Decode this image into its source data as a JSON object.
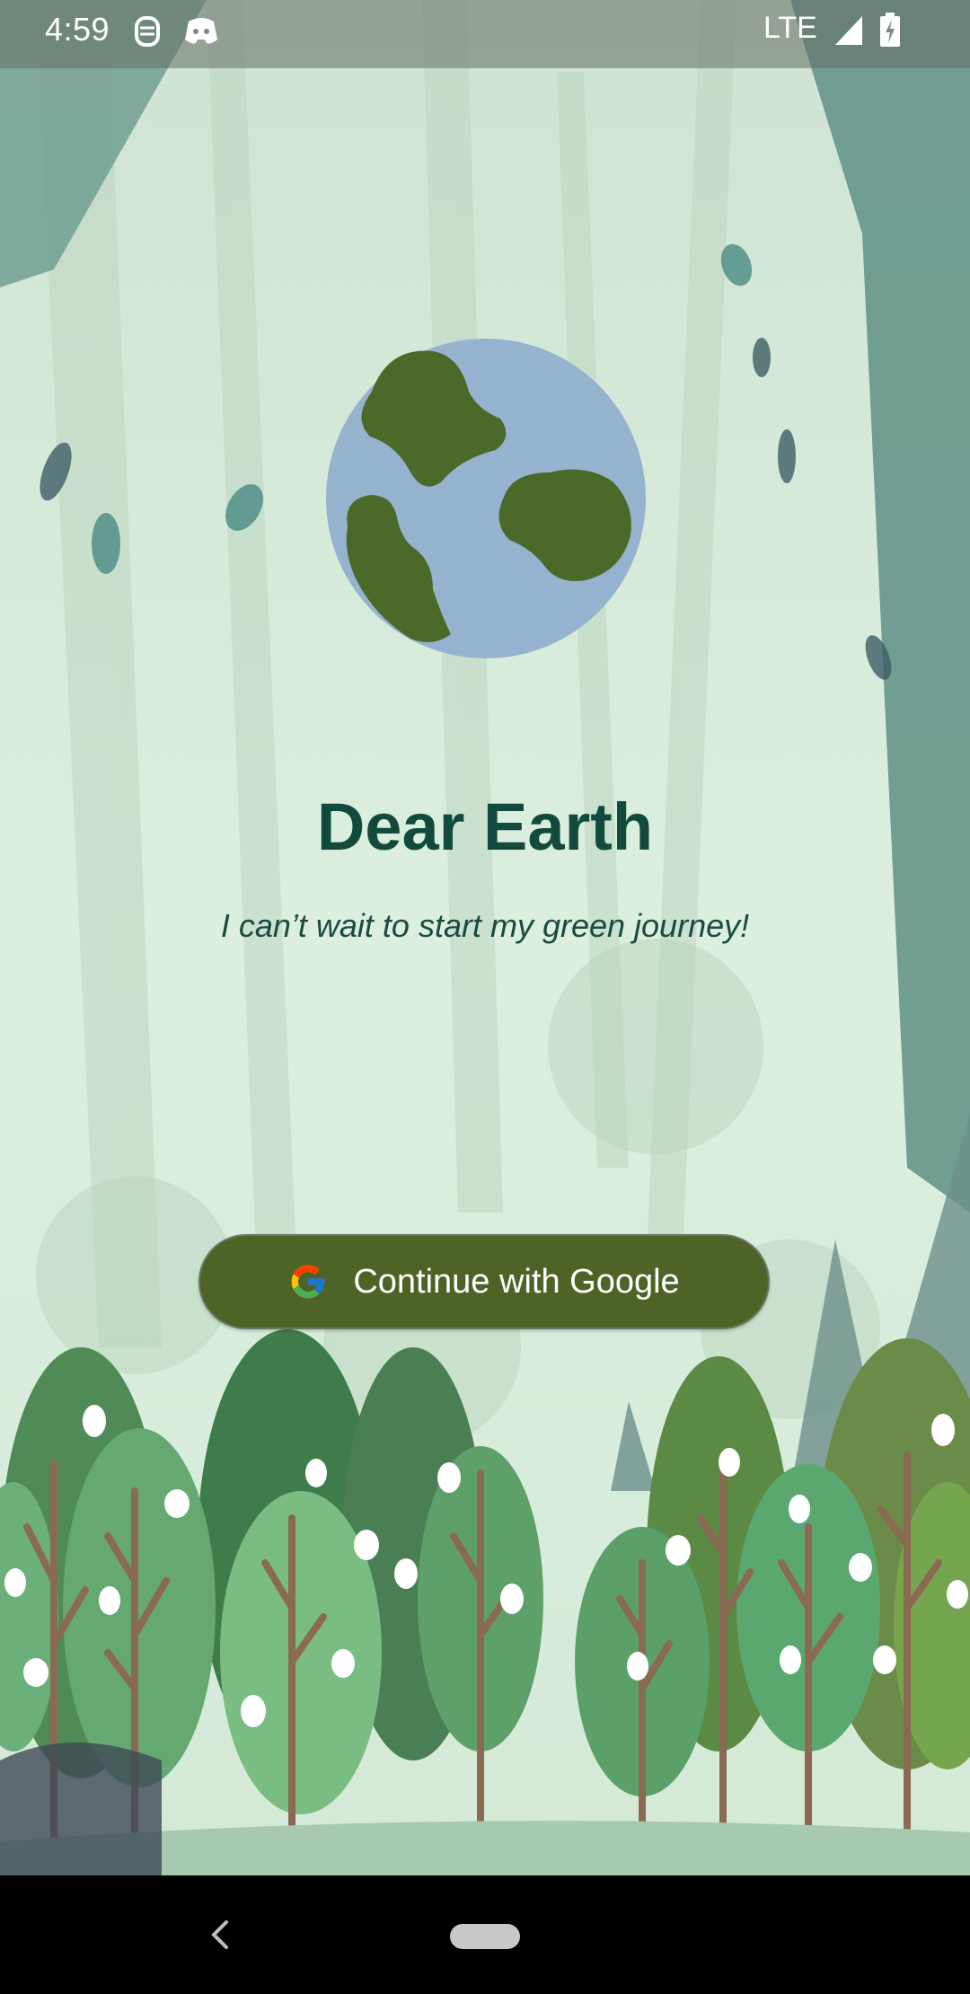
{
  "status_bar": {
    "time": "4:59",
    "network": "LTE",
    "icons": [
      "notification-badge-icon",
      "discord-icon",
      "signal-icon",
      "battery-charging-icon"
    ]
  },
  "app": {
    "logo_icon": "earth-icon",
    "title": "Dear Earth",
    "tagline": "I can’t wait to start my green journey!"
  },
  "login": {
    "google_button_label": "Continue with Google",
    "google_icon": "google-g-icon"
  },
  "colors": {
    "title": "#124a3e",
    "button_bg": "#4e6427",
    "earth_water": "#95b3cf",
    "earth_land": "#4b6a2a",
    "background": "#d8ebd9"
  },
  "nav_bar": {
    "icons": [
      "back-icon",
      "home-pill-icon"
    ]
  }
}
